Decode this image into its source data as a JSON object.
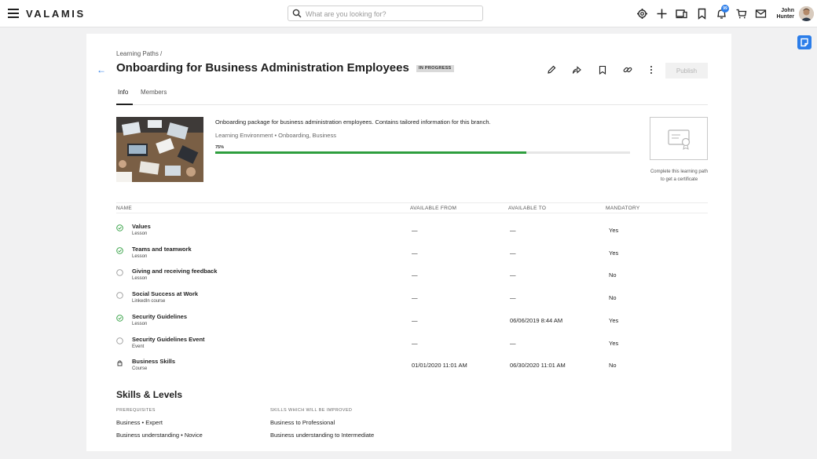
{
  "app": {
    "logo": "VALAMIS"
  },
  "search": {
    "placeholder": "What are you looking for?"
  },
  "topbar": {
    "notification_count": "99",
    "user_first": "John",
    "user_last": "Hunter"
  },
  "page": {
    "breadcrumb": "Learning Paths /",
    "title": "Onboarding for Business Administration Employees",
    "status": "IN PROGRESS",
    "publish_label": "Publish"
  },
  "tabs": [
    {
      "label": "Info"
    },
    {
      "label": "Members"
    }
  ],
  "overview": {
    "description": "Onboarding package for business administration employees. Contains tailored information for this branch.",
    "meta": "Learning Environment • Onboarding, Business",
    "progress_label": "75%",
    "progress_value": 0.75,
    "certificate_text": "Complete this learning path to get a certificate"
  },
  "table": {
    "headers": {
      "name": "NAME",
      "from": "AVAILABLE FROM",
      "to": "AVAILABLE TO",
      "mandatory": "MANDATORY"
    },
    "rows": [
      {
        "name": "Values",
        "type": "Lesson",
        "from": "—",
        "to": "—",
        "mandatory": "Yes",
        "status": "done"
      },
      {
        "name": "Teams and teamwork",
        "type": "Lesson",
        "from": "—",
        "to": "—",
        "mandatory": "Yes",
        "status": "done"
      },
      {
        "name": "Giving and receiving feedback",
        "type": "Lesson",
        "from": "—",
        "to": "—",
        "mandatory": "No",
        "status": "todo"
      },
      {
        "name": "Social Success at Work",
        "type": "LinkedIn course",
        "from": "—",
        "to": "—",
        "mandatory": "No",
        "status": "todo"
      },
      {
        "name": "Security Guidelines",
        "type": "Lesson",
        "from": "—",
        "to": "06/06/2019 8:44 AM",
        "mandatory": "Yes",
        "status": "done"
      },
      {
        "name": "Security Guidelines Event",
        "type": "Event",
        "from": "—",
        "to": "—",
        "mandatory": "Yes",
        "status": "todo"
      },
      {
        "name": "Business Skills",
        "type": "Course",
        "from": "01/01/2020 11:01 AM",
        "to": "06/30/2020 11:01 AM",
        "mandatory": "No",
        "status": "locked"
      }
    ]
  },
  "skills": {
    "title": "Skills & Levels",
    "prereq_heading": "PREREQUISITES",
    "improved_heading": "SKILLS WHICH WILL BE IMPROVED",
    "prerequisites": [
      "Business • Expert",
      "Business understanding • Novice"
    ],
    "improved": [
      "Business to Professional",
      "Business understanding to Intermediate"
    ]
  },
  "colors": {
    "accent": "#2b7de9",
    "progress": "#2e9e3e",
    "done": "#2e9e3e"
  }
}
